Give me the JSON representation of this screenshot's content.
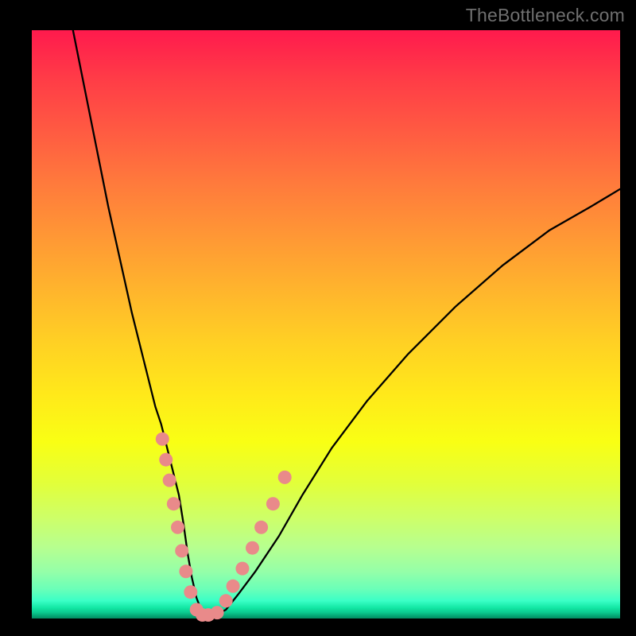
{
  "watermark": "TheBottleneck.com",
  "colors": {
    "frame": "#000000",
    "gradient_top": "#ff1a4d",
    "gradient_bottom": "#028c62",
    "curve": "#000000",
    "marker_fill": "#e98a8a",
    "marker_stroke": "#d86a6a"
  },
  "chart_data": {
    "type": "line",
    "title": "",
    "xlabel": "",
    "ylabel": "",
    "xlim": [
      0,
      100
    ],
    "ylim": [
      0,
      100
    ],
    "note": "Axes are unlabeled; values are estimates of pixel-normalized percent. The black curve is a V-shaped bottleneck curve. Salmon markers cluster near the bottom of the V.",
    "series": [
      {
        "name": "bottleneck-curve",
        "x": [
          7,
          9,
          11,
          13,
          15,
          17,
          19,
          20,
          21,
          22,
          23,
          24,
          25,
          25.8,
          26.5,
          27.2,
          28,
          28.8,
          29.7,
          31,
          33,
          35,
          38,
          42,
          46,
          51,
          57,
          64,
          72,
          80,
          88,
          95,
          100
        ],
        "y": [
          100,
          90,
          80,
          70,
          61,
          52,
          44,
          40,
          36,
          33,
          29,
          25,
          21,
          16,
          11,
          7,
          3.5,
          1.4,
          0.4,
          0.4,
          1.5,
          4,
          8,
          14,
          21,
          29,
          37,
          45,
          53,
          60,
          66,
          70,
          73
        ]
      },
      {
        "name": "markers-left",
        "x": [
          22.2,
          22.8,
          23.4,
          24.1,
          24.8,
          25.5,
          26.2,
          27.0
        ],
        "y": [
          30.5,
          27.0,
          23.5,
          19.5,
          15.5,
          11.5,
          8.0,
          4.5
        ]
      },
      {
        "name": "markers-bottom",
        "x": [
          28.0,
          29.0,
          30.0,
          31.5
        ],
        "y": [
          1.5,
          0.6,
          0.6,
          1.0
        ]
      },
      {
        "name": "markers-right",
        "x": [
          33.0,
          34.2,
          35.8,
          37.5,
          39.0,
          41.0,
          43.0
        ],
        "y": [
          3.0,
          5.5,
          8.5,
          12.0,
          15.5,
          19.5,
          24.0
        ]
      }
    ]
  }
}
